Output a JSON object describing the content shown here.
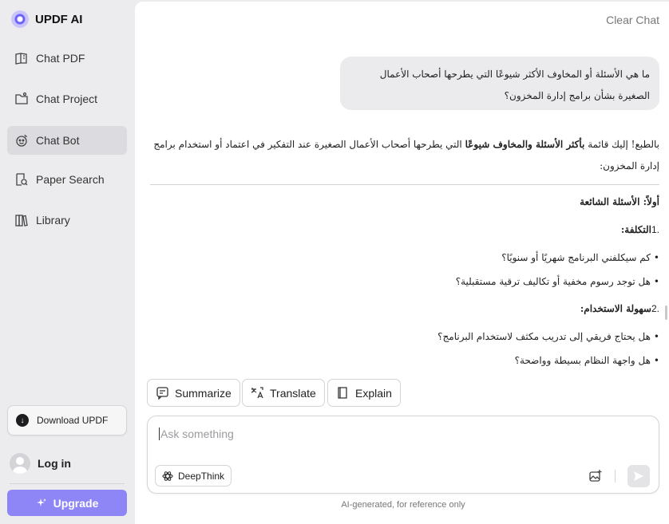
{
  "app": {
    "name": "UPDF AI"
  },
  "sidebar": {
    "items": [
      {
        "label": "Chat PDF",
        "icon": "book-open-icon",
        "active": false
      },
      {
        "label": "Chat Project",
        "icon": "folder-chat-icon",
        "active": false
      },
      {
        "label": "Chat Bot",
        "icon": "bot-icon",
        "active": true
      },
      {
        "label": "Paper Search",
        "icon": "document-search-icon",
        "active": false
      },
      {
        "label": "Library",
        "icon": "books-icon",
        "active": false
      }
    ],
    "download_label": "Download UPDF",
    "login_label": "Log in",
    "upgrade_label": "Upgrade"
  },
  "header": {
    "clear_chat_label": "Clear Chat"
  },
  "conversation": {
    "user_message": "ما هي الأسئلة أو المخاوف الأكثر شيوعًا التي يطرحها أصحاب الأعمال الصغيرة بشأن برامج إدارة المخزون؟",
    "ai": {
      "intro_before": "بالطبع! إليك قائمة ",
      "intro_bold": "بأكثر الأسئلة والمخاوف شيوعًا",
      "intro_after": " التي يطرحها أصحاب الأعمال الصغيرة عند التفكير في اعتماد أو استخدام برامج إدارة المخزون:",
      "section_heading": "أولاً: الأسئلة الشائعة",
      "groups": [
        {
          "number": "1.",
          "title": "التكلفة:",
          "questions": [
            "كم سيكلفني البرنامج شهريًا أو سنويًا؟",
            "هل توجد رسوم مخفية أو تكاليف ترقية مستقبلية؟"
          ]
        },
        {
          "number": "2.",
          "title": "سهولة الاستخدام:",
          "questions": [
            "هل يحتاج فريقي إلى تدريب مكثف لاستخدام البرنامج؟",
            "هل واجهة النظام بسيطة وواضحة؟"
          ]
        }
      ]
    }
  },
  "actions": [
    {
      "label": "Summarize",
      "icon": "summarize-icon"
    },
    {
      "label": "Translate",
      "icon": "translate-icon"
    },
    {
      "label": "Explain",
      "icon": "book-icon"
    }
  ],
  "composer": {
    "placeholder": "Ask something",
    "deepthink_label": "DeepThink"
  },
  "footer": {
    "disclaimer": "AI-generated, for reference only"
  },
  "colors": {
    "accent": "#8e86f6",
    "sidebar_bg": "#ececee",
    "active_item_bg": "#dcdce0"
  }
}
